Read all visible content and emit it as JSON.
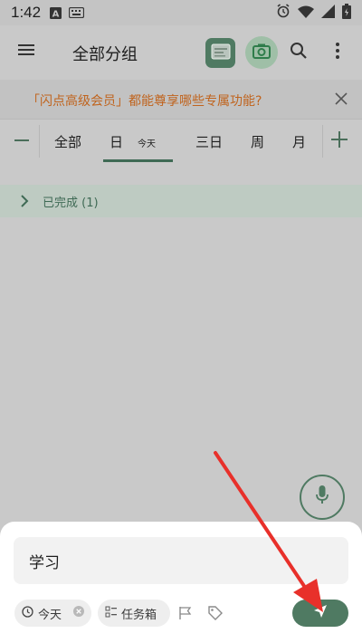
{
  "status_bar": {
    "time": "1:42",
    "icons": [
      "a-notification-icon",
      "keyboard-icon",
      "alarm-icon",
      "wifi-icon",
      "signal-icon",
      "battery-icon"
    ]
  },
  "app_bar": {
    "title": "全部分组",
    "icons": [
      "menu-icon",
      "scan-icon",
      "camera-icon",
      "search-icon",
      "more-vert-icon"
    ]
  },
  "promo": {
    "text": "「闪点高级会员」都能尊享哪些专属功能?",
    "close_icon": "close-icon"
  },
  "tabs": {
    "items": [
      {
        "label": "全部"
      },
      {
        "label": "日",
        "sub": "今天"
      },
      {
        "label": "三日"
      },
      {
        "label": "周"
      },
      {
        "label": "月"
      }
    ],
    "selected": "日"
  },
  "completed_group": {
    "label": "已完成 (1)"
  },
  "composer": {
    "input_value": "学习",
    "date_chip": "今天",
    "box_chip": "任务箱"
  },
  "colors": {
    "accent": "#4f7a62",
    "promo_text": "#c0641e",
    "annotation": "#e8302a"
  }
}
